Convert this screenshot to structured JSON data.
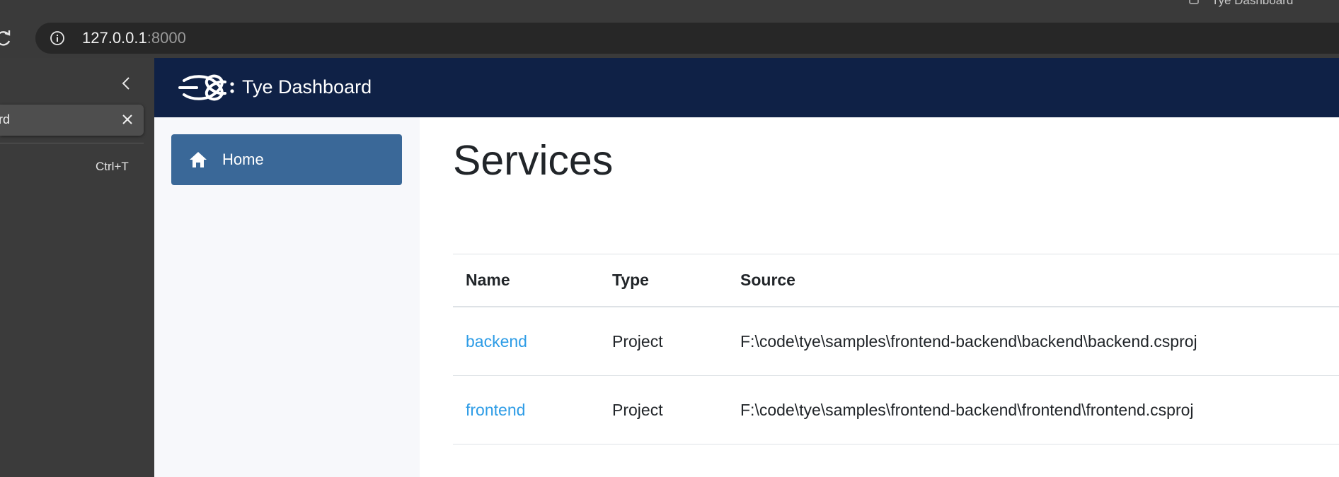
{
  "window": {
    "title": "Tye Dashboard"
  },
  "browser": {
    "url_host": "127.0.0.1",
    "url_port": ":8000",
    "sidepanel": {
      "tab_title": "rd",
      "new_tab_shortcut": "Ctrl+T"
    }
  },
  "app": {
    "brand": "Tye Dashboard",
    "nav": [
      {
        "label": "Home",
        "icon": "home-icon",
        "active": true
      }
    ],
    "page_title": "Services",
    "table": {
      "headers": [
        "Name",
        "Type",
        "Source"
      ],
      "rows": [
        {
          "name": "backend",
          "type": "Project",
          "source": "F:\\code\\tye\\samples\\frontend-backend\\backend\\backend.csproj"
        },
        {
          "name": "frontend",
          "type": "Project",
          "source": "F:\\code\\tye\\samples\\frontend-backend\\frontend\\frontend.csproj"
        }
      ]
    }
  },
  "colors": {
    "header_bg": "#0f2146",
    "nav_active": "#3a6898",
    "link": "#2d9ce6"
  }
}
